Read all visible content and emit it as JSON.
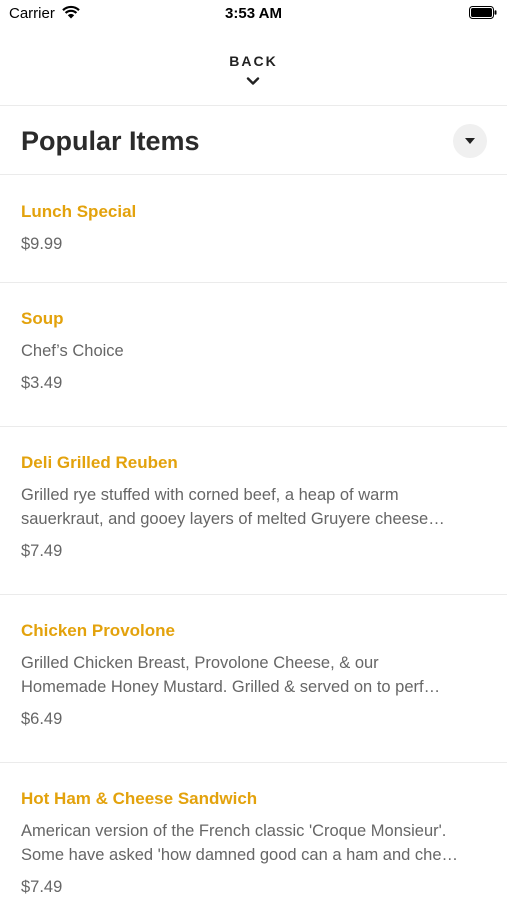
{
  "status_bar": {
    "carrier": "Carrier",
    "time": "3:53 AM"
  },
  "nav": {
    "back_label": "BACK"
  },
  "section": {
    "title": "Popular Items"
  },
  "colors": {
    "item_name": "#e3a20c",
    "text_secondary": "#666666",
    "divider": "#ebebeb"
  },
  "menu_items": [
    {
      "name": "Lunch Special",
      "price": "$9.99"
    },
    {
      "name": "Soup",
      "desc": [
        "Chef’s Choice"
      ],
      "price": "$3.49"
    },
    {
      "name": "Deli Grilled Reuben",
      "desc": [
        "Grilled rye stuffed with corned beef, a heap of warm",
        "sauerkraut, and gooey layers of melted Gruyere cheese…"
      ],
      "price": "$7.49"
    },
    {
      "name": "Chicken Provolone",
      "desc": [
        "Grilled Chicken Breast, Provolone Cheese, & our",
        "Homemade Honey Mustard. Grilled & served on to perf…"
      ],
      "price": "$6.49"
    },
    {
      "name": "Hot Ham & Cheese Sandwich",
      "desc": [
        "American version of the French classic 'Croque Monsieur'.",
        "Some have asked 'how damned good can a ham and che…"
      ],
      "price": "$7.49"
    }
  ]
}
